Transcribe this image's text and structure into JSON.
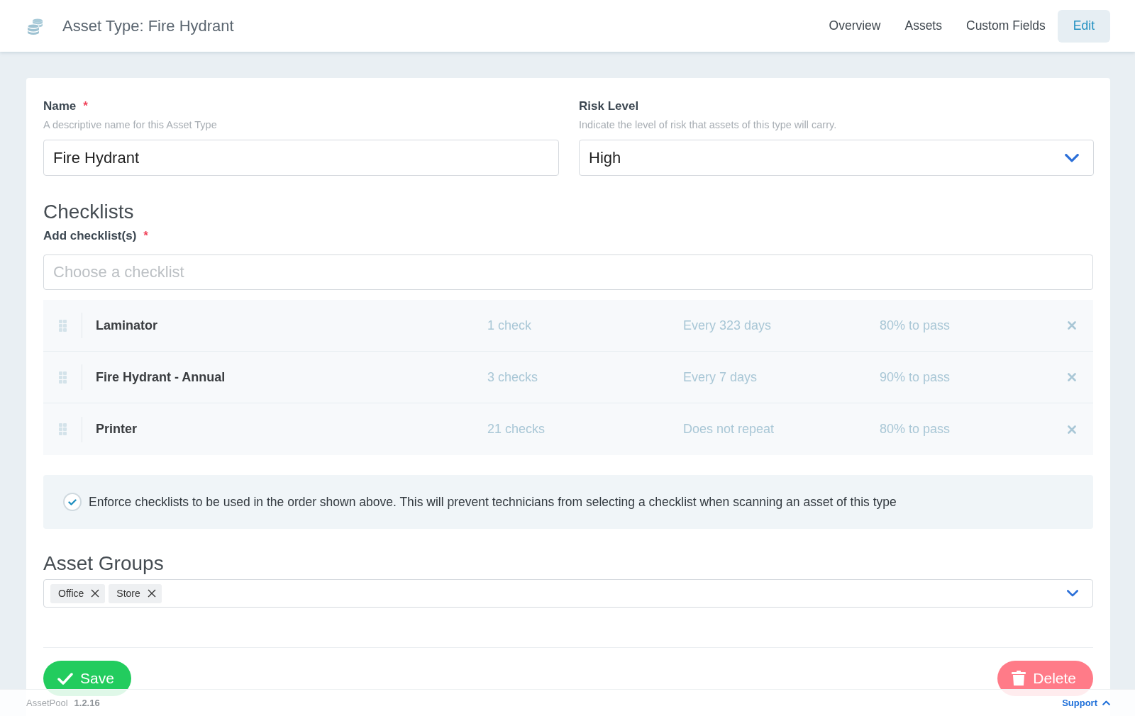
{
  "header": {
    "title": "Asset Type: Fire Hydrant",
    "tabs": [
      {
        "label": "Overview",
        "selected": false
      },
      {
        "label": "Assets",
        "selected": false
      },
      {
        "label": "Custom Fields",
        "selected": false
      },
      {
        "label": "Edit",
        "selected": true
      }
    ]
  },
  "name_field": {
    "label": "Name",
    "required_mark": "*",
    "hint": "A descriptive name for this Asset Type",
    "value": "Fire Hydrant"
  },
  "risk_level_field": {
    "label": "Risk Level",
    "hint": "Indicate the level of risk that assets of this type will carry.",
    "value": "High"
  },
  "checklists": {
    "heading": "Checklists",
    "label": "Add checklist(s)",
    "required_mark": "*",
    "placeholder": "Choose a checklist",
    "rows": [
      {
        "name": "Laminator",
        "checks": "1 check",
        "repeat": "Every 323 days",
        "pass": "80% to pass"
      },
      {
        "name": "Fire Hydrant - Annual",
        "checks": "3 checks",
        "repeat": "Every 7 days",
        "pass": "90% to pass"
      },
      {
        "name": "Printer",
        "checks": "21 checks",
        "repeat": "Does not repeat",
        "pass": "80% to pass"
      }
    ],
    "enforce": {
      "checked": true,
      "text": "Enforce checklists to be used in the order shown above. This will prevent technicians from selecting a checklist when scanning an asset of this type"
    }
  },
  "asset_groups": {
    "heading": "Asset Groups",
    "tags": [
      "Office",
      "Store"
    ]
  },
  "actions": {
    "save": "Save",
    "delete": "Delete"
  },
  "footer": {
    "app": "AssetPool",
    "version": "1.2.16",
    "support": "Support"
  }
}
